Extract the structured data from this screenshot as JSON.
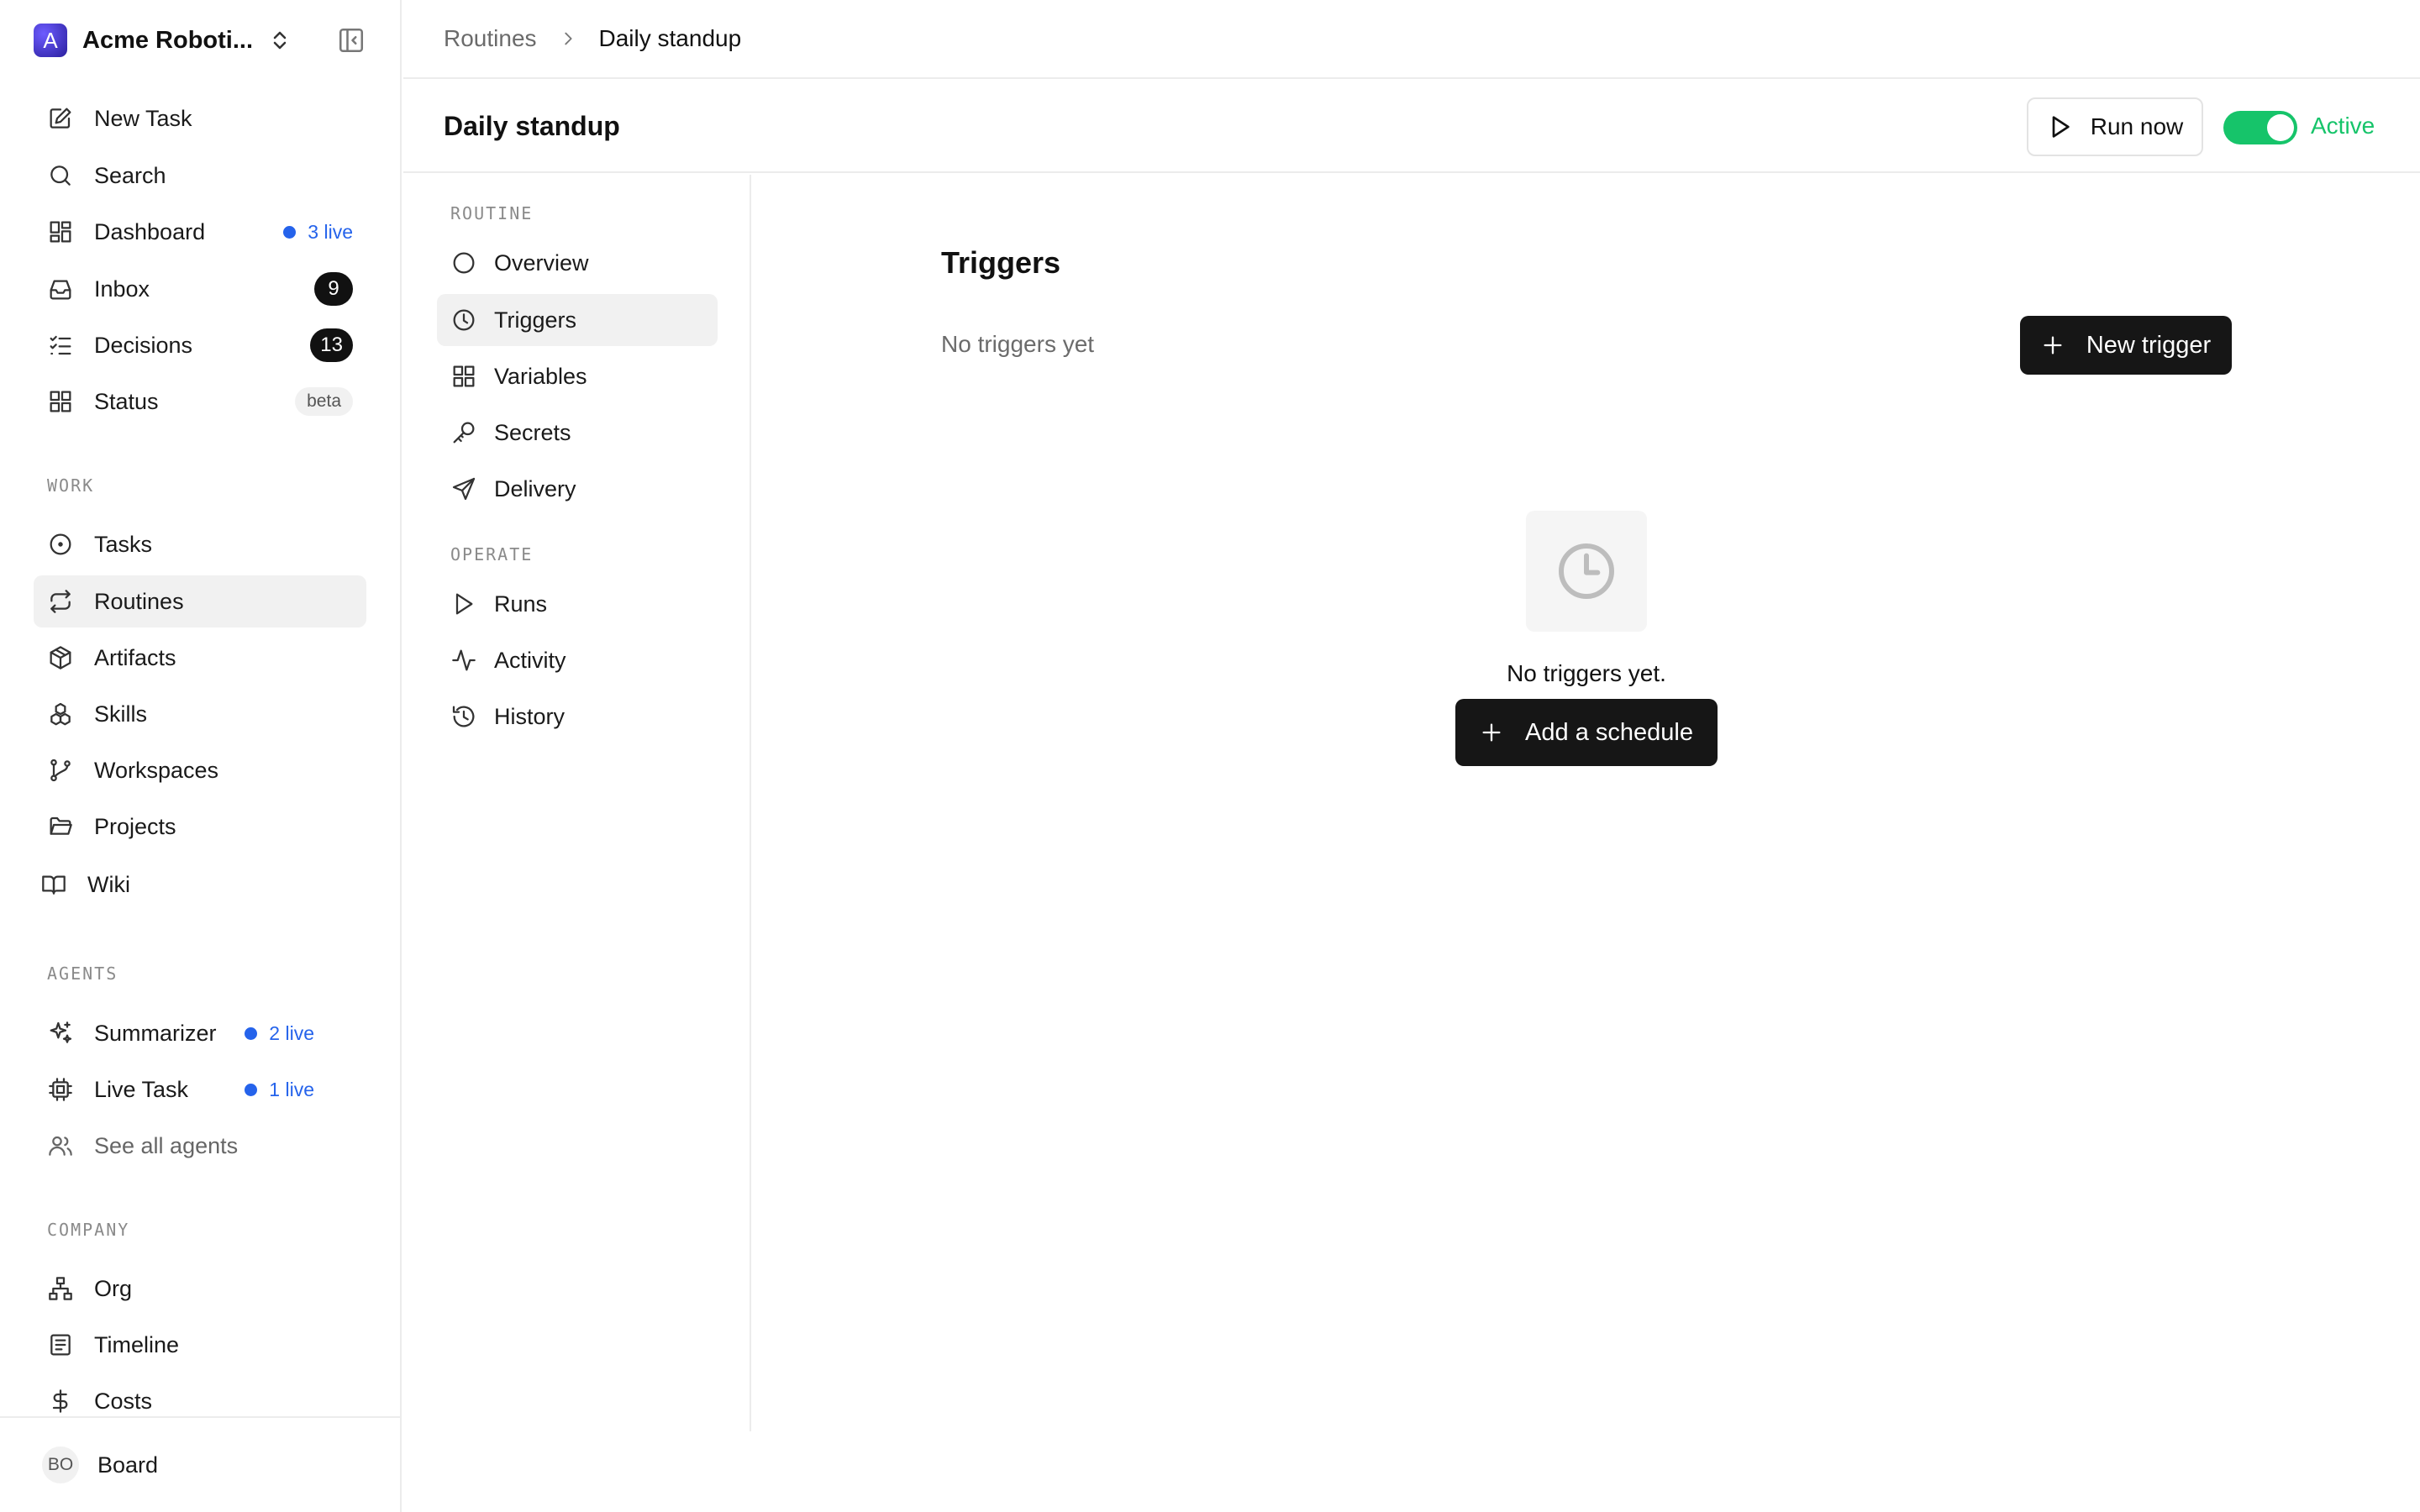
{
  "workspace": {
    "initial": "A",
    "name": "Acme Roboti...",
    "icons": {
      "switcher": "chevrons-up-down-icon",
      "collapse": "sidebar-collapse-icon"
    }
  },
  "sidebar": {
    "top_items": [
      {
        "label": "New Task",
        "icon": "edit-icon"
      },
      {
        "label": "Search",
        "icon": "search-icon"
      },
      {
        "label": "Dashboard",
        "icon": "dashboard-icon",
        "live": "3 live"
      },
      {
        "label": "Inbox",
        "icon": "inbox-icon",
        "count": "9"
      },
      {
        "label": "Decisions",
        "icon": "checklist-icon",
        "count": "13"
      },
      {
        "label": "Status",
        "icon": "grid-icon",
        "badge": "beta"
      }
    ],
    "work_label": "WORK",
    "work_items": [
      {
        "label": "Tasks",
        "icon": "circle-dot-icon"
      },
      {
        "label": "Routines",
        "icon": "repeat-icon",
        "active": true
      },
      {
        "label": "Artifacts",
        "icon": "package-icon"
      },
      {
        "label": "Skills",
        "icon": "blocks-icon"
      },
      {
        "label": "Workspaces",
        "icon": "git-branch-icon"
      },
      {
        "label": "Projects",
        "icon": "folder-icon"
      },
      {
        "label": "Wiki",
        "icon": "book-icon"
      }
    ],
    "agents_label": "AGENTS",
    "agent_items": [
      {
        "label": "Summarizer",
        "icon": "sparkles-icon",
        "live": "2 live"
      },
      {
        "label": "Live Task",
        "icon": "cpu-icon",
        "live": "1 live"
      },
      {
        "label": "See all agents",
        "icon": "users-icon"
      }
    ],
    "company_label": "COMPANY",
    "company_items": [
      {
        "label": "Org",
        "icon": "org-chart-icon"
      },
      {
        "label": "Timeline",
        "icon": "timeline-icon"
      },
      {
        "label": "Costs",
        "icon": "dollar-icon"
      }
    ],
    "footer": {
      "avatar": "BO",
      "label": "Board"
    }
  },
  "breadcrumb": {
    "parent": "Routines",
    "current": "Daily standup"
  },
  "header": {
    "title": "Daily standup",
    "run_now": "Run now",
    "status_label": "Active",
    "toggle_on": true,
    "accent": "#16c46a"
  },
  "subnav": {
    "routine_label": "ROUTINE",
    "routine_items": [
      {
        "label": "Overview",
        "icon": "circle-icon"
      },
      {
        "label": "Triggers",
        "icon": "clock-icon",
        "active": true
      },
      {
        "label": "Variables",
        "icon": "grid-icon"
      },
      {
        "label": "Secrets",
        "icon": "key-icon"
      },
      {
        "label": "Delivery",
        "icon": "send-icon"
      }
    ],
    "operate_label": "OPERATE",
    "operate_items": [
      {
        "label": "Runs",
        "icon": "play-icon"
      },
      {
        "label": "Activity",
        "icon": "activity-icon"
      },
      {
        "label": "History",
        "icon": "history-icon"
      }
    ]
  },
  "triggers": {
    "title": "Triggers",
    "empty_subtitle": "No triggers yet",
    "new_button": "New trigger",
    "empty_message": "No triggers yet.",
    "add_button": "Add a schedule"
  }
}
